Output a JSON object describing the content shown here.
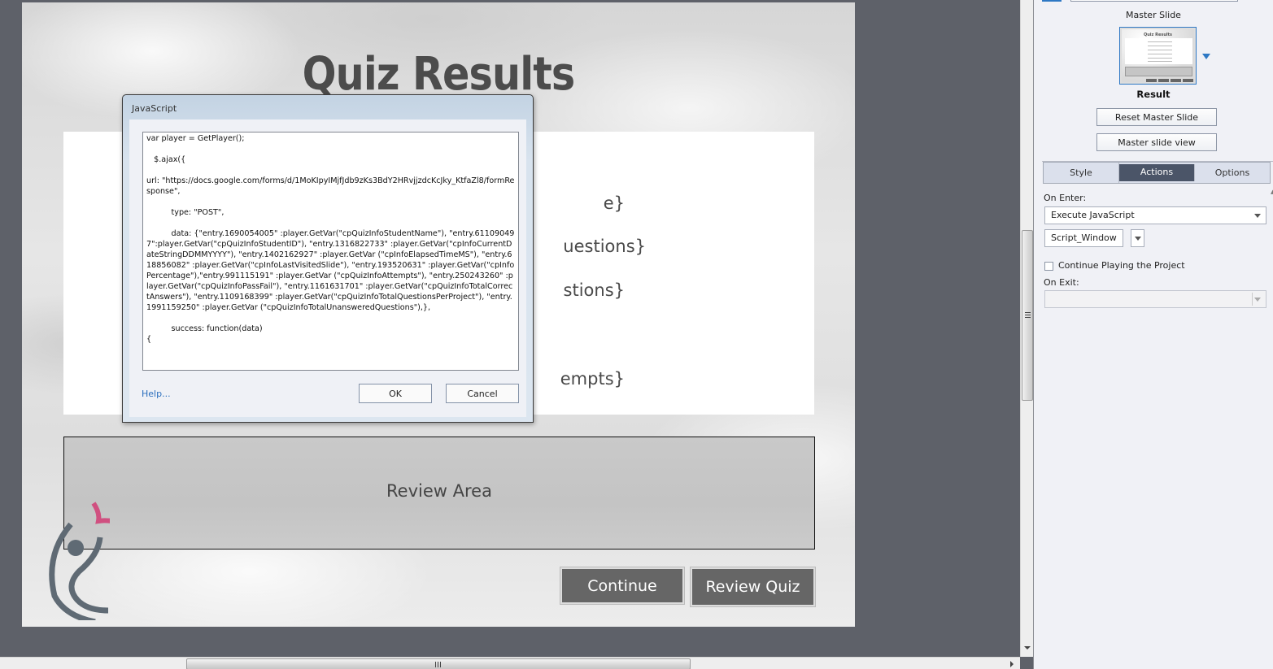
{
  "slide": {
    "title": "Quiz Results",
    "result_lines_visible_fragments": [
      "e}",
      "uestions}",
      "stions}",
      "empts}"
    ],
    "review_area_label": "Review Area",
    "buttons": {
      "continue": "Continue",
      "review_quiz": "Review Quiz"
    }
  },
  "dialog": {
    "title": "JavaScript",
    "code": "var player = GetPlayer();\n\n   $.ajax({\n\nurl: \"https://docs.google.com/forms/d/1MoKIpyIMjfJdb9zKs3BdY2HRvjjzdcKcJky_KtfaZl8/formResponse\",\n\n          type: \"POST\",\n\n          data: {\"entry.1690054005\" :player.GetVar(\"cpQuizInfoStudentName\"), \"entry.611090497\":player.GetVar(\"cpQuizInfoStudentID\"), \"entry.1316822733\" :player.GetVar(\"cpInfoCurrentDateStringDDMMYYYY\"), \"entry.1402162927\" :player.GetVar (\"cpInfoElapsedTimeMS\"), \"entry.618856082\" :player.GetVar(\"cpInfoLastVisitedSlide\"), \"entry.193520631\" :player.GetVar(\"cpInfoPercentage\"),\"entry.991115191\" :player.GetVar (\"cpQuizInfoAttempts\"), \"entry.250243260\" :player.GetVar(\"cpQuizInfoPassFail\"), \"entry.1161631701\" :player.GetVar(\"cpQuizInfoTotalCorrectAnswers\"), \"entry.1109168399\" :player.GetVar(\"cpQuizInfoTotalQuestionsPerProject\"), \"entry.1991159250\" :player.GetVar (\"cpQuizInfoTotalUnansweredQuestions\"),},\n\n          success: function(data)\n{",
    "help_label": "Help...",
    "ok_label": "OK",
    "cancel_label": "Cancel"
  },
  "properties": {
    "master_slide_label": "Master Slide",
    "master_slide_name": "Result",
    "thumbnail_title": "Quiz Results",
    "reset_master_label": "Reset Master Slide",
    "master_view_label": "Master slide view",
    "tabs": [
      {
        "label": "Style",
        "active": false
      },
      {
        "label": "Actions",
        "active": true
      },
      {
        "label": "Options",
        "active": false
      }
    ],
    "on_enter_label": "On Enter:",
    "on_enter_value": "Execute JavaScript",
    "script_window_label": "Script_Window",
    "continue_playing_label": "Continue Playing the Project",
    "continue_playing_checked": false,
    "on_exit_label": "On Exit:",
    "on_exit_value": ""
  },
  "icons": {
    "logo": "dancing-figure-logo",
    "dropdown": "triangle-down",
    "scroll_right": "triangle-right"
  },
  "colors": {
    "canvas_bg": "#5e6169",
    "button_bg": "#666666",
    "active_tab": "#4b5568",
    "accent_blue": "#2e78c4",
    "logo_pink": "#d05080",
    "logo_gray": "#5f6a74"
  }
}
